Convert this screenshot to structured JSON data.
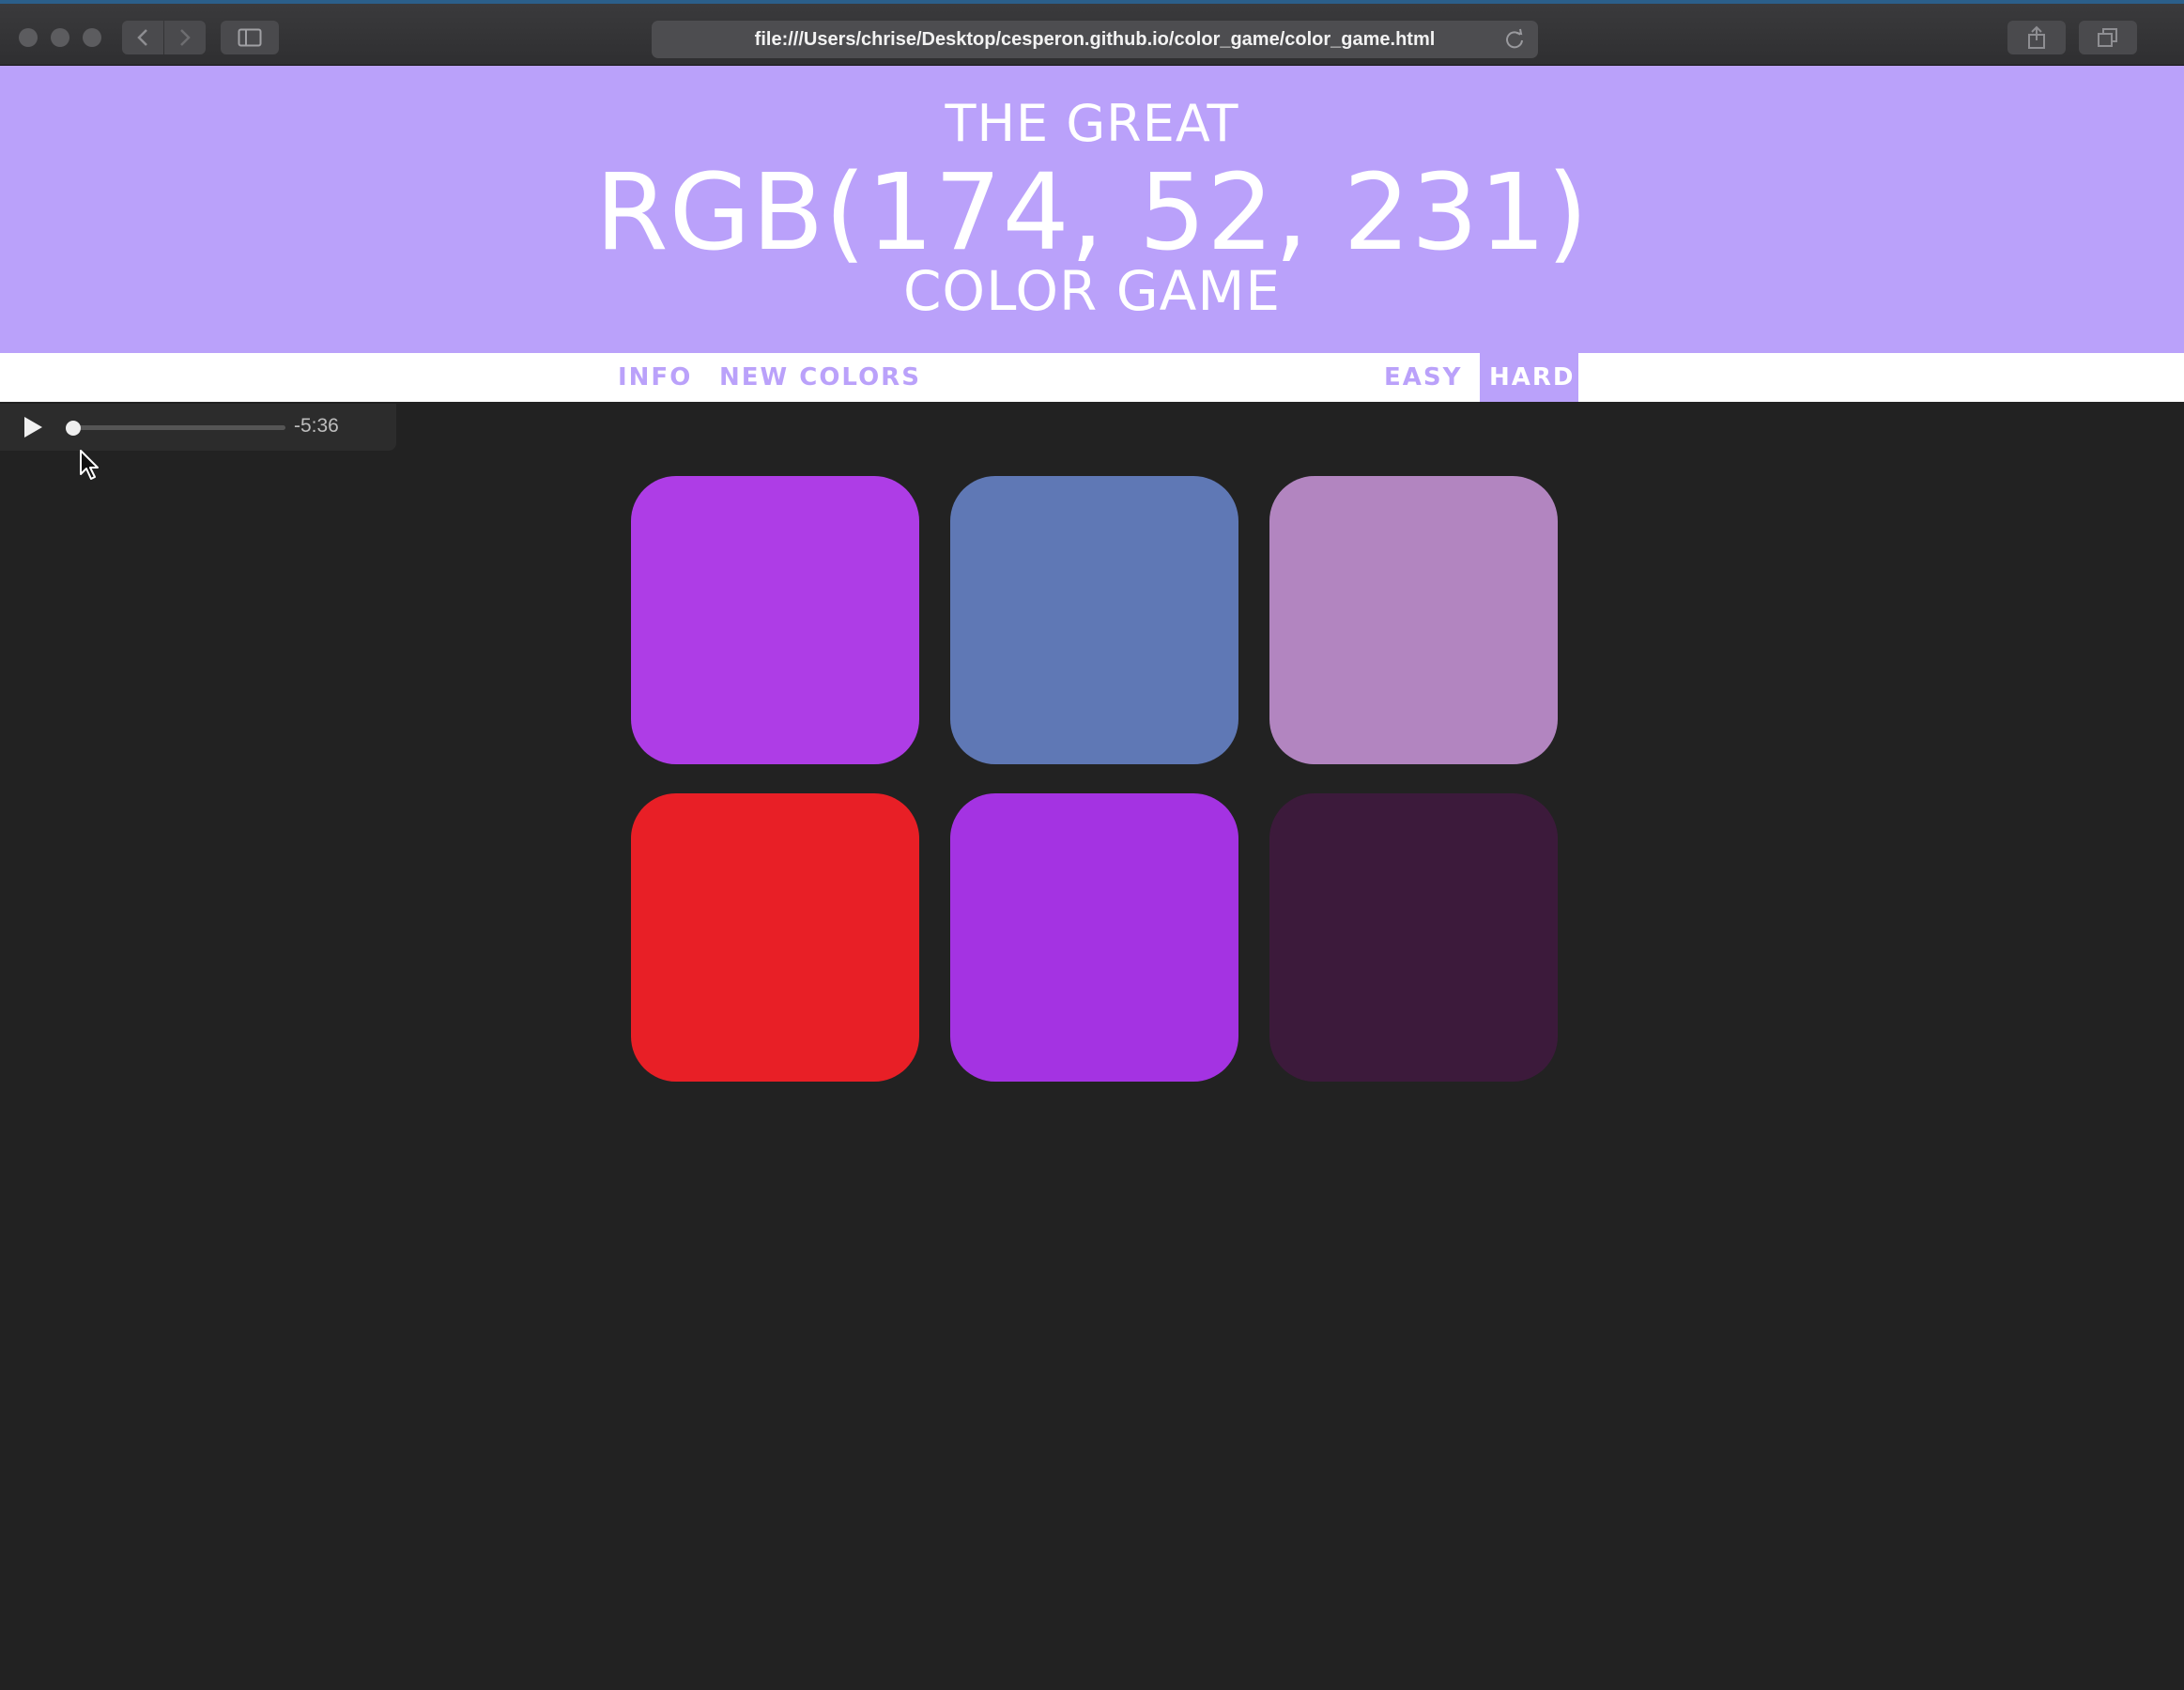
{
  "browser": {
    "url": "file:///Users/chrise/Desktop/cesperon.github.io/color_game/color_game.html"
  },
  "header": {
    "line1": "THE GREAT",
    "rgb_display": "RGB(174, 52, 231)",
    "line3": "COLOR GAME",
    "background_color": "#baa1fa"
  },
  "nav": {
    "info_label": "INFO",
    "new_colors_label": "NEW COLORS",
    "easy_label": "EASY",
    "hard_label": "HARD",
    "selected_mode": "HARD"
  },
  "player": {
    "time_remaining": "-5:36",
    "progress": 0.0
  },
  "squares": [
    {
      "color": "#ae3de6"
    },
    {
      "color": "#5f78b5"
    },
    {
      "color": "#b285c0"
    },
    {
      "color": "#e81f26"
    },
    {
      "color": "#a433e2"
    },
    {
      "color": "#3c1a3b"
    }
  ],
  "page_background": "#222222"
}
